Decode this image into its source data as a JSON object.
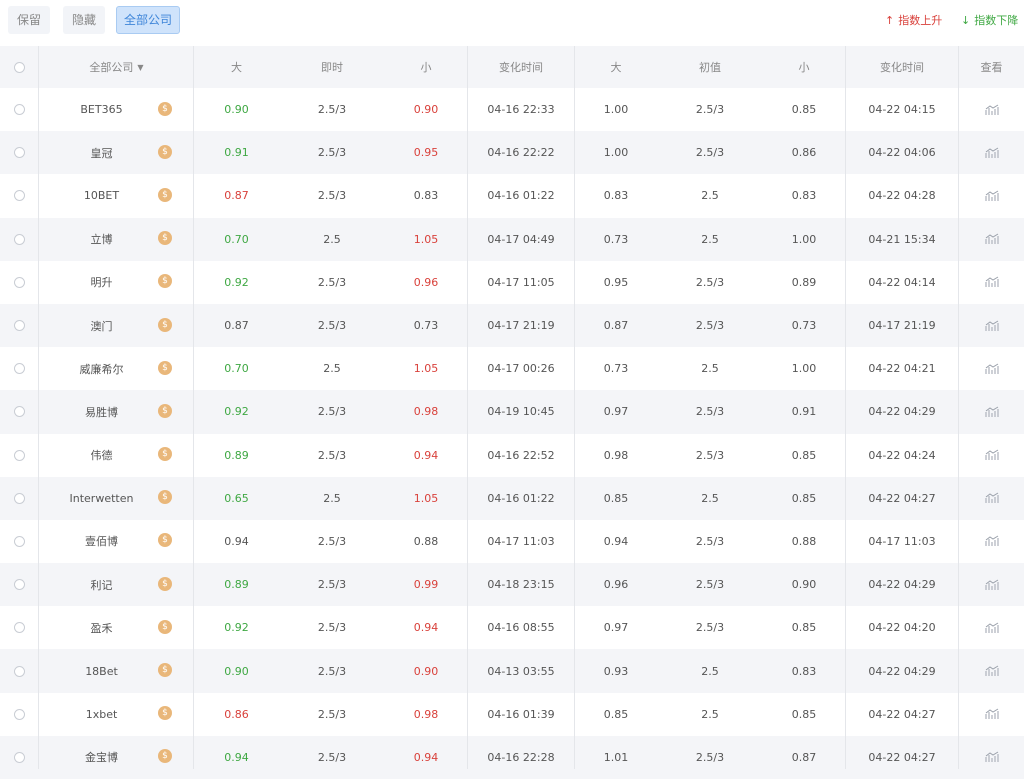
{
  "toolbar": {
    "keep_label": "保留",
    "hide_label": "隐藏",
    "all_label": "全部公司",
    "rise_label": "指数上升",
    "fall_label": "指数下降"
  },
  "colors": {
    "up": "#d9413b",
    "down": "#3fa843",
    "active_tab": "#3f86d9"
  },
  "header": {
    "company": "全部公司",
    "big": "大",
    "instant": "即时",
    "small": "小",
    "change_time": "变化时间",
    "big2": "大",
    "initial": "初值",
    "small2": "小",
    "change_time2": "变化时间",
    "view": "查看"
  },
  "rows": [
    {
      "name": "BET365",
      "big": "0.90",
      "bc": "g",
      "line": "2.5/3",
      "small": "0.90",
      "sc": "r",
      "time": "04-16 22:33",
      "ibig": "1.00",
      "iline": "2.5/3",
      "ismall": "0.85",
      "itime": "04-22 04:15"
    },
    {
      "name": "皇冠",
      "big": "0.91",
      "bc": "g",
      "line": "2.5/3",
      "small": "0.95",
      "sc": "r",
      "time": "04-16 22:22",
      "ibig": "1.00",
      "iline": "2.5/3",
      "ismall": "0.86",
      "itime": "04-22 04:06"
    },
    {
      "name": "10BET",
      "big": "0.87",
      "bc": "r",
      "line": "2.5/3",
      "small": "0.83",
      "sc": "n",
      "time": "04-16 01:22",
      "ibig": "0.83",
      "iline": "2.5",
      "ismall": "0.83",
      "itime": "04-22 04:28"
    },
    {
      "name": "立博",
      "big": "0.70",
      "bc": "g",
      "line": "2.5",
      "small": "1.05",
      "sc": "r",
      "time": "04-17 04:49",
      "ibig": "0.73",
      "iline": "2.5",
      "ismall": "1.00",
      "itime": "04-21 15:34"
    },
    {
      "name": "明升",
      "big": "0.92",
      "bc": "g",
      "line": "2.5/3",
      "small": "0.96",
      "sc": "r",
      "time": "04-17 11:05",
      "ibig": "0.95",
      "iline": "2.5/3",
      "ismall": "0.89",
      "itime": "04-22 04:14"
    },
    {
      "name": "澳门",
      "big": "0.87",
      "bc": "n",
      "line": "2.5/3",
      "small": "0.73",
      "sc": "n",
      "time": "04-17 21:19",
      "ibig": "0.87",
      "iline": "2.5/3",
      "ismall": "0.73",
      "itime": "04-17 21:19"
    },
    {
      "name": "威廉希尔",
      "big": "0.70",
      "bc": "g",
      "line": "2.5",
      "small": "1.05",
      "sc": "r",
      "time": "04-17 00:26",
      "ibig": "0.73",
      "iline": "2.5",
      "ismall": "1.00",
      "itime": "04-22 04:21"
    },
    {
      "name": "易胜博",
      "big": "0.92",
      "bc": "g",
      "line": "2.5/3",
      "small": "0.98",
      "sc": "r",
      "time": "04-19 10:45",
      "ibig": "0.97",
      "iline": "2.5/3",
      "ismall": "0.91",
      "itime": "04-22 04:29"
    },
    {
      "name": "伟德",
      "big": "0.89",
      "bc": "g",
      "line": "2.5/3",
      "small": "0.94",
      "sc": "r",
      "time": "04-16 22:52",
      "ibig": "0.98",
      "iline": "2.5/3",
      "ismall": "0.85",
      "itime": "04-22 04:24"
    },
    {
      "name": "Interwetten",
      "big": "0.65",
      "bc": "g",
      "line": "2.5",
      "small": "1.05",
      "sc": "r",
      "time": "04-16 01:22",
      "ibig": "0.85",
      "iline": "2.5",
      "ismall": "0.85",
      "itime": "04-22 04:27"
    },
    {
      "name": "壹佰博",
      "big": "0.94",
      "bc": "n",
      "line": "2.5/3",
      "small": "0.88",
      "sc": "n",
      "time": "04-17 11:03",
      "ibig": "0.94",
      "iline": "2.5/3",
      "ismall": "0.88",
      "itime": "04-17 11:03"
    },
    {
      "name": "利记",
      "big": "0.89",
      "bc": "g",
      "line": "2.5/3",
      "small": "0.99",
      "sc": "r",
      "time": "04-18 23:15",
      "ibig": "0.96",
      "iline": "2.5/3",
      "ismall": "0.90",
      "itime": "04-22 04:29"
    },
    {
      "name": "盈禾",
      "big": "0.92",
      "bc": "g",
      "line": "2.5/3",
      "small": "0.94",
      "sc": "r",
      "time": "04-16 08:55",
      "ibig": "0.97",
      "iline": "2.5/3",
      "ismall": "0.85",
      "itime": "04-22 04:20"
    },
    {
      "name": "18Bet",
      "big": "0.90",
      "bc": "g",
      "line": "2.5/3",
      "small": "0.90",
      "sc": "r",
      "time": "04-13 03:55",
      "ibig": "0.93",
      "iline": "2.5",
      "ismall": "0.83",
      "itime": "04-22 04:29"
    },
    {
      "name": "1xbet",
      "big": "0.86",
      "bc": "r",
      "line": "2.5/3",
      "small": "0.98",
      "sc": "r",
      "time": "04-16 01:39",
      "ibig": "0.85",
      "iline": "2.5",
      "ismall": "0.85",
      "itime": "04-22 04:27"
    },
    {
      "name": "金宝博",
      "big": "0.94",
      "bc": "g",
      "line": "2.5/3",
      "small": "0.94",
      "sc": "r",
      "time": "04-16 22:28",
      "ibig": "1.01",
      "iline": "2.5/3",
      "ismall": "0.87",
      "itime": "04-22 04:27"
    }
  ]
}
